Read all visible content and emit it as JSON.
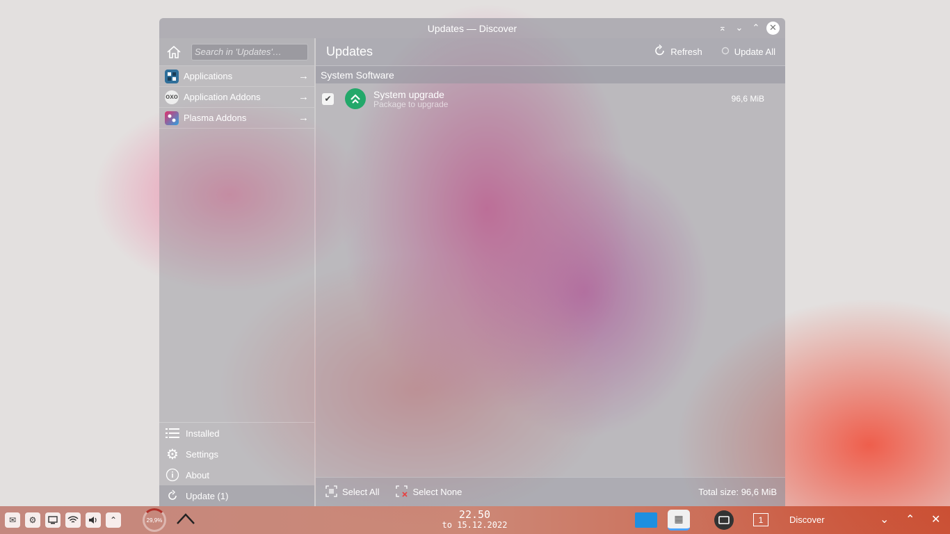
{
  "window": {
    "title": "Updates — Discover",
    "controls": {
      "keep_above": "⌅",
      "minimize": "⌄",
      "maximize": "⌃",
      "close": "✕"
    }
  },
  "sidebar": {
    "search_placeholder": "Search in 'Updates'…",
    "categories": [
      {
        "label": "Applications",
        "icon": "applications-icon"
      },
      {
        "label": "Application Addons",
        "icon": "application-addons-icon"
      },
      {
        "label": "Plasma Addons",
        "icon": "plasma-addons-icon"
      }
    ],
    "nav": {
      "installed": "Installed",
      "settings": "Settings",
      "about": "About",
      "update": "Update (1)"
    }
  },
  "main": {
    "title": "Updates",
    "refresh": "Refresh",
    "update_all": "Update All",
    "section": "System Software",
    "item": {
      "name": "System upgrade",
      "subtitle": "Package to upgrade",
      "size": "96,6 MiB",
      "checked": true
    },
    "footer": {
      "select_all": "Select All",
      "select_none": "Select None",
      "total_size": "Total size: 96,6 MiB"
    }
  },
  "taskbar": {
    "cpu_load": "29,9%",
    "time": "22.50",
    "date": "to 15.12.2022",
    "desktop_number": "1",
    "active_title": "Discover",
    "accent_color": "#1e8fe0",
    "upgrade_icon_color": "#23a86a"
  }
}
